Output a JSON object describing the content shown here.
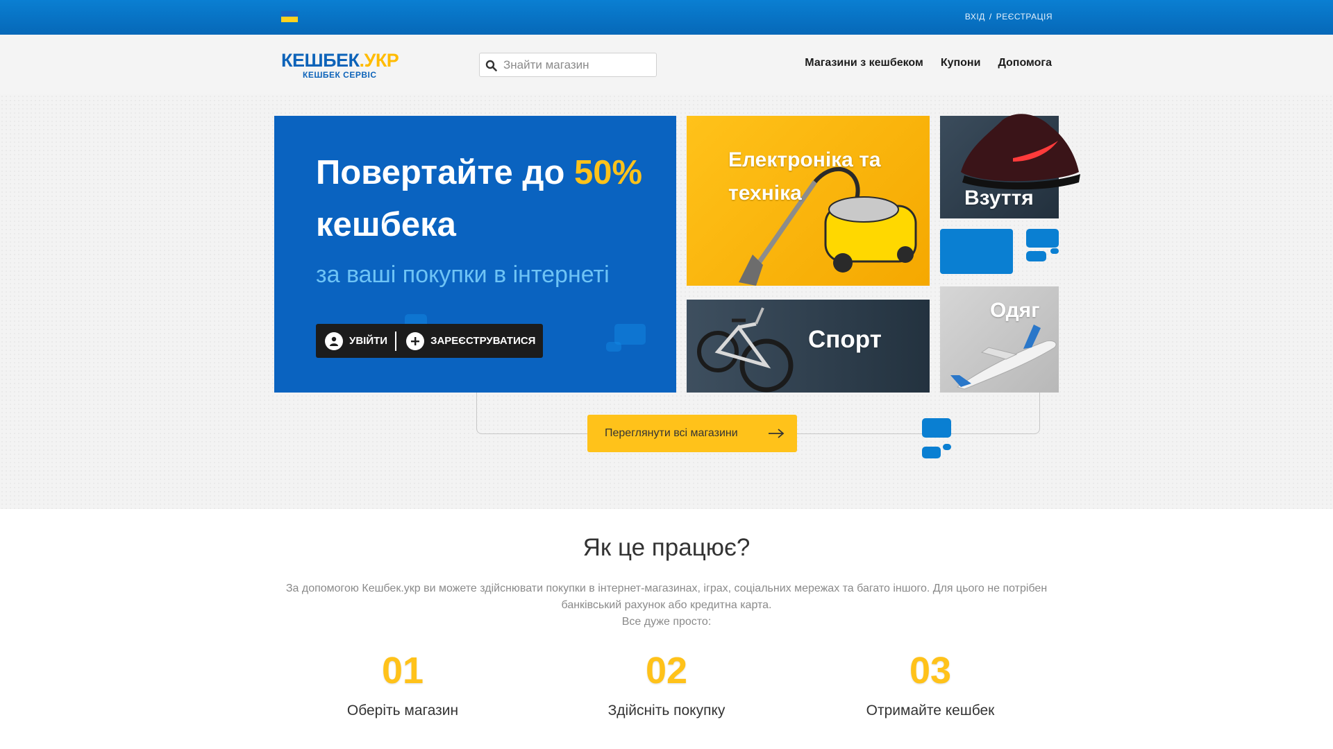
{
  "topbar": {
    "login_label": "ВХІД",
    "separator": "/",
    "register_label": "РЕЄСТРАЦІЯ",
    "colors": {
      "flag_blue": "#1a66c4",
      "flag_yellow": "#ffd21f",
      "bar": "#0a7fd2"
    }
  },
  "header": {
    "logo": {
      "main": "КЕШБЕК",
      "dot_part": ".УКР",
      "sub": "КЕШБЕК СЕРВІС"
    },
    "search": {
      "placeholder": "Знайти магазин",
      "value": "",
      "icon": "search-icon"
    },
    "nav": [
      "Магазини з кешбеком",
      "Купони",
      "Допомога"
    ]
  },
  "hero": {
    "headline_part1": "Повертайте до ",
    "headline_accent": "50%",
    "headline_part2": "кешбека",
    "subheadline": "за ваші покупки в інтернеті",
    "login_button": "УВІЙТИ",
    "register_button": "ЗАРЕЄСТРУВАТИСЯ",
    "tiles": {
      "electronics": "Електроніка та техніка",
      "shoes": "Взуття",
      "sport": "Спорт",
      "clothes": "Одяг"
    },
    "cta": "Переглянути всі магазини",
    "colors": {
      "promo_bg": "#0a63c0",
      "accent": "#ffc21a"
    }
  },
  "how": {
    "title": "Як це працює?",
    "description_line1": "За допомогою Кешбек.укр ви можете здійснювати покупки в інтернет-магазинах, іграх, соціальних мережах та багато іншого. Для цього не потрібен банківський рахунок або кредитна карта.",
    "description_line2": "Все дуже просто:",
    "steps": [
      {
        "num": "01",
        "caption": "Оберіть магазин"
      },
      {
        "num": "02",
        "caption": "Здійсніть покупку"
      },
      {
        "num": "03",
        "caption": "Отримайте кешбек"
      }
    ]
  }
}
